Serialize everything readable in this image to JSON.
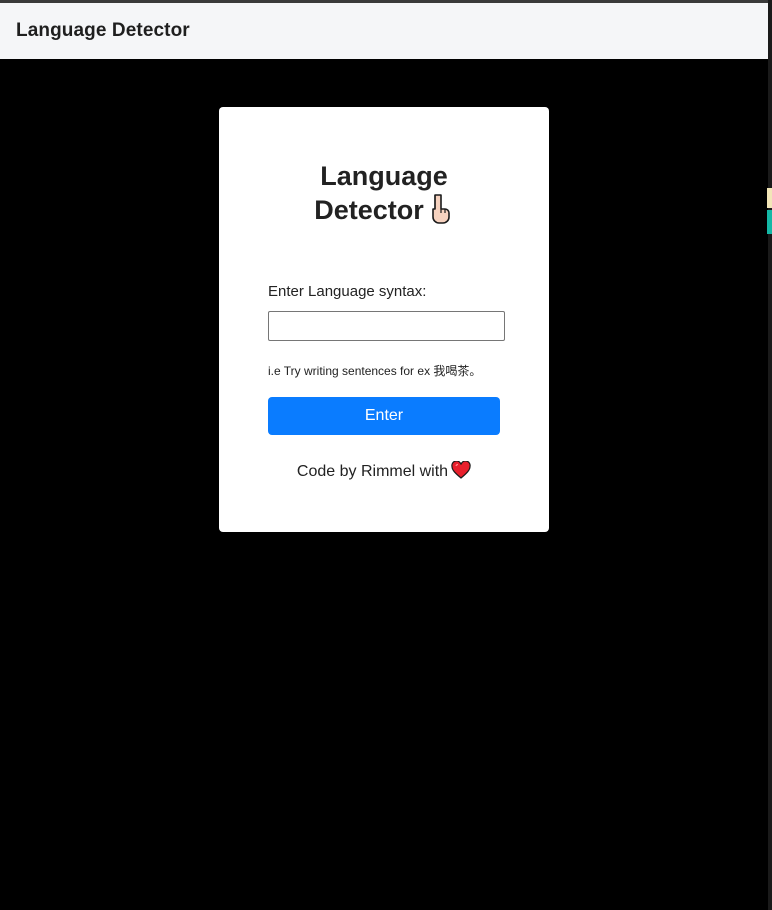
{
  "navbar": {
    "brand": "Language Detector"
  },
  "card": {
    "title_line1": "Language",
    "title_line2": "Detector",
    "title_icon": "pointing-down-hand-icon",
    "input_label": "Enter Language syntax:",
    "input_value": "",
    "hint": "i.e Try writing sentences for ex 我喝茶。",
    "enter_label": "Enter",
    "credit": "Code by Rimmel with",
    "credit_icon": "heart-icon"
  },
  "colors": {
    "primary": "#0a7cff",
    "page_bg": "#000000",
    "navbar_bg": "#f5f6f8",
    "heart": "#e8202c"
  }
}
